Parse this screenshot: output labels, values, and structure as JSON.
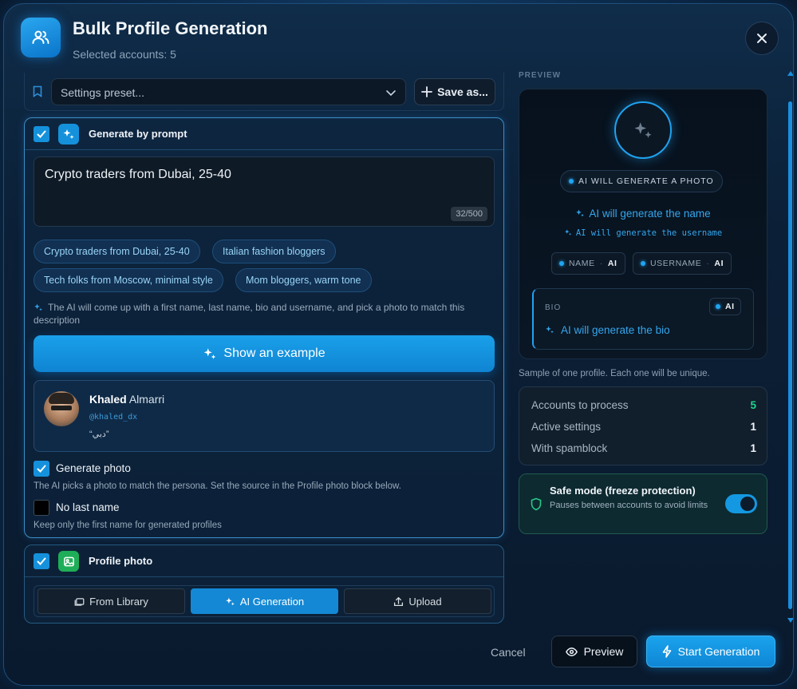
{
  "header": {
    "title": "Bulk Profile Generation",
    "subtitle": "Selected accounts: 5"
  },
  "preset": {
    "placeholder": "Settings preset...",
    "save_label": "Save as..."
  },
  "prompt_section": {
    "title": "Generate by prompt",
    "checked": true,
    "prompt_text": "Crypto traders from Dubai, 25-40",
    "counter": "32/500",
    "suggestions": [
      "Crypto traders from Dubai, 25-40",
      "Italian fashion bloggers",
      "Tech folks from Moscow, minimal style",
      "Mom bloggers, warm tone"
    ],
    "hint": "The AI will come up with a first name, last name, bio and username, and pick a photo to match this description",
    "example_button": "Show an example",
    "example": {
      "first_name": "Khaled",
      "last_name": "Almarri",
      "username": "@khaled_dx",
      "bio": "“دبي”"
    },
    "generate_photo": {
      "label": "Generate photo",
      "checked": true,
      "desc": "The AI picks a photo to match the persona. Set the source in the Profile photo block below."
    },
    "no_last_name": {
      "label": "No last name",
      "checked": false,
      "desc": "Keep only the first name for generated profiles"
    }
  },
  "photo_section": {
    "title": "Profile photo",
    "checked": true,
    "options": [
      "From Library",
      "AI Generation",
      "Upload"
    ],
    "active": "AI Generation"
  },
  "preview": {
    "label": "PREVIEW",
    "photo_pill": "AI WILL GENERATE A PHOTO",
    "name_line": "AI will generate the name",
    "username_line": "AI will generate the username",
    "name_tag": "NAME",
    "username_tag": "USERNAME",
    "ai_tag": "AI",
    "bio_label": "BIO",
    "bio_line": "AI will generate the bio",
    "note": "Sample of one profile. Each one will be unique."
  },
  "stats": [
    {
      "label": "Accounts to process",
      "value": "5"
    },
    {
      "label": "Active settings",
      "value": "1"
    },
    {
      "label": "With spamblock",
      "value": "1"
    }
  ],
  "safe_mode": {
    "title": "Safe mode (freeze protection)",
    "desc": "Pauses between accounts to avoid limits",
    "enabled": true
  },
  "footer": {
    "cancel": "Cancel",
    "preview": "Preview",
    "start": "Start Generation"
  },
  "colors": {
    "accent": "#1a9fea",
    "success": "#22d38d",
    "background": "#0a1a2e"
  }
}
